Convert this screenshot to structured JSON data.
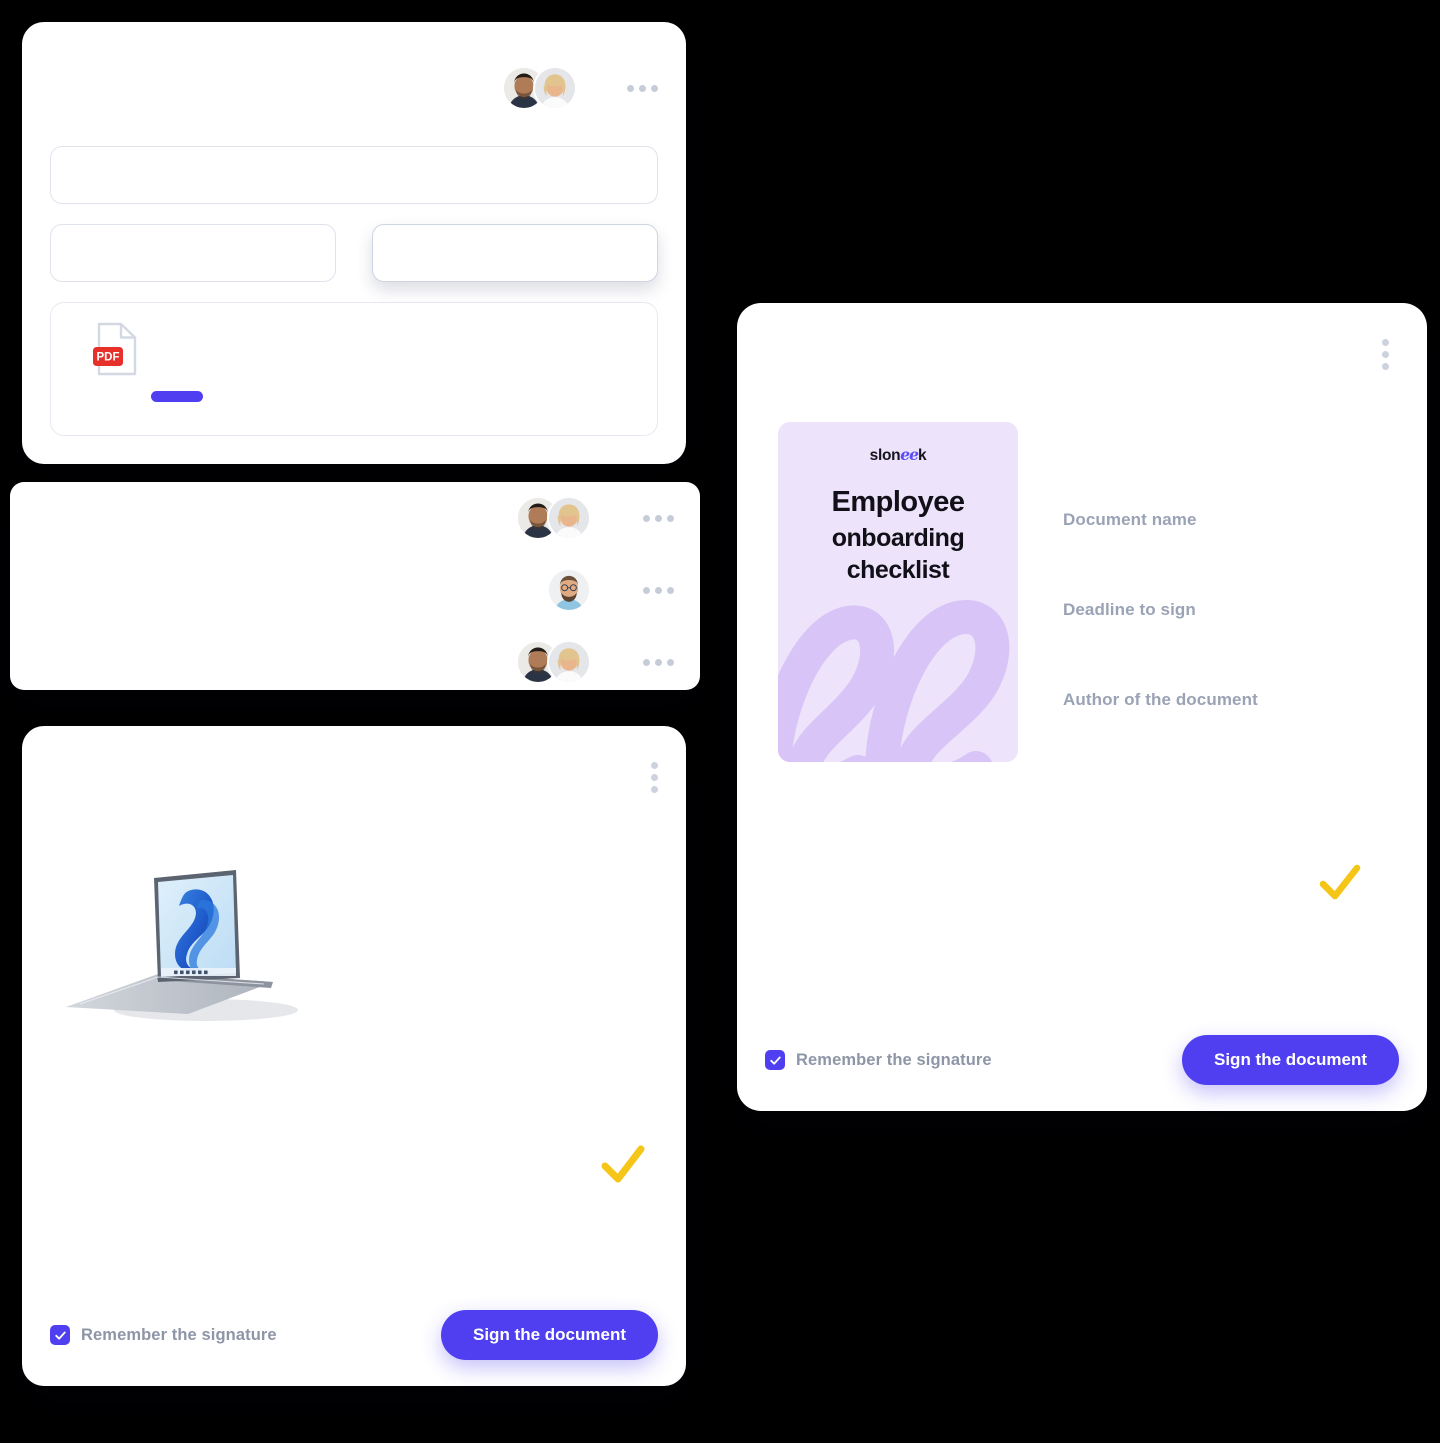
{
  "theme": {
    "accent": "#4f3ff0",
    "check_yellow": "#f5c518",
    "label_gray": "#9aa3b5",
    "thumb_bg": "#ede4fb",
    "pdf_red": "#e8302a",
    "page_bg": "#000000"
  },
  "form_card": {
    "menu_icon": "ellipsis-horizontal-icon",
    "avatars": [
      {
        "name": "avatar-man-dark-hair"
      },
      {
        "name": "avatar-woman-blonde"
      }
    ],
    "fields": [
      {
        "name": "field-full-width",
        "value": "",
        "placeholder": ""
      },
      {
        "name": "field-left",
        "value": "",
        "placeholder": ""
      },
      {
        "name": "field-right-focused",
        "value": "",
        "placeholder": ""
      }
    ],
    "upload": {
      "file_icon": "pdf-file-icon",
      "file_type_label": "PDF",
      "action_pill": "purple-pill-placeholder"
    }
  },
  "list_card": {
    "rows": [
      {
        "menu_icon": "ellipsis-horizontal-icon",
        "avatars": [
          "avatar-man-dark-hair",
          "avatar-woman-blonde"
        ]
      },
      {
        "menu_icon": "ellipsis-horizontal-icon",
        "avatars": [
          "avatar-man-beard-glasses"
        ]
      },
      {
        "menu_icon": "ellipsis-horizontal-icon",
        "avatars": [
          "avatar-man-dark-hair",
          "avatar-woman-blonde"
        ]
      }
    ]
  },
  "sign_card_left": {
    "menu_icon": "ellipsis-vertical-icon",
    "preview_image": "laptop-windows11-image",
    "status_icon": "yellow-checkmark-icon",
    "checkbox": {
      "checked": true,
      "label": "Remember the signature",
      "icon": "checkmark-icon"
    },
    "primary_button": "Sign the document"
  },
  "document_card": {
    "menu_icon": "ellipsis-vertical-icon",
    "thumbnail": {
      "logo_prefix": "slon",
      "logo_script": "ee",
      "logo_suffix": "k",
      "title_line_1": "Employee",
      "title_line_2": "onboarding",
      "title_line_3": "checklist",
      "watermark_icon": "sloneek-ee-swirl-icon"
    },
    "fields": [
      {
        "label": "Document name",
        "value": ""
      },
      {
        "label": "Deadline to sign",
        "value": ""
      },
      {
        "label": "Author of the document",
        "value": ""
      }
    ],
    "status_icon": "yellow-checkmark-icon",
    "checkbox": {
      "checked": true,
      "label": "Remember the signature",
      "icon": "checkmark-icon"
    },
    "primary_button": "Sign the document"
  }
}
